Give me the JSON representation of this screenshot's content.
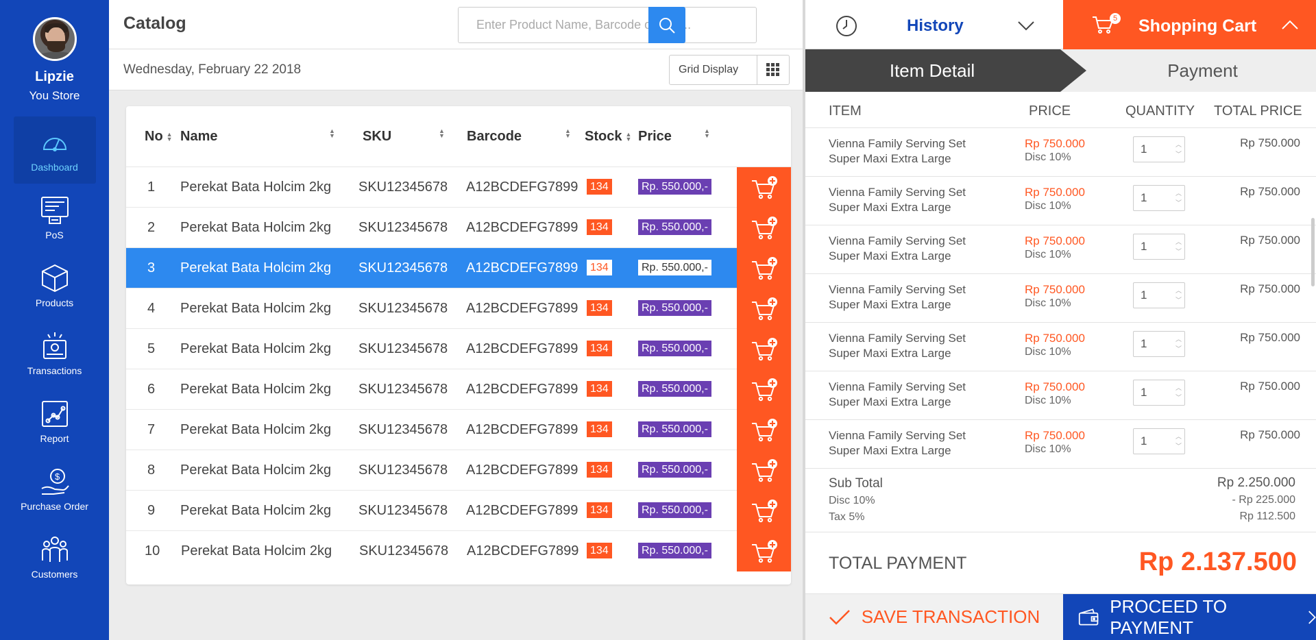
{
  "user": {
    "name": "Lipzie",
    "store": "You Store"
  },
  "nav": [
    {
      "label": "Dashboard",
      "icon": "dashboard-icon",
      "active": true
    },
    {
      "label": "PoS",
      "icon": "pos-icon"
    },
    {
      "label": "Products",
      "icon": "products-icon"
    },
    {
      "label": "Transactions",
      "icon": "transactions-icon"
    },
    {
      "label": "Report",
      "icon": "report-icon"
    },
    {
      "label": "Purchase Order",
      "icon": "purchase-order-icon"
    },
    {
      "label": "Customers",
      "icon": "customers-icon"
    }
  ],
  "catalog": {
    "title": "Catalog",
    "search_placeholder": "Enter Product Name, Barcode or SKU..",
    "date": "Wednesday, February 22 2018",
    "display_mode": "Grid Display",
    "columns": [
      "No",
      "Name",
      "SKU",
      "Barcode",
      "Stock",
      "Price"
    ],
    "rows": [
      {
        "no": "1",
        "name": "Perekat Bata Holcim 2kg",
        "sku": "SKU12345678",
        "barcode": "A12BCDEFG7899",
        "stock": "134",
        "price": "Rp. 550.000,-"
      },
      {
        "no": "2",
        "name": "Perekat Bata Holcim 2kg",
        "sku": "SKU12345678",
        "barcode": "A12BCDEFG7899",
        "stock": "134",
        "price": "Rp. 550.000,-"
      },
      {
        "no": "3",
        "name": "Perekat Bata Holcim 2kg",
        "sku": "SKU12345678",
        "barcode": "A12BCDEFG7899",
        "stock": "134",
        "price": "Rp. 550.000,-",
        "selected": true
      },
      {
        "no": "4",
        "name": "Perekat Bata Holcim 2kg",
        "sku": "SKU12345678",
        "barcode": "A12BCDEFG7899",
        "stock": "134",
        "price": "Rp. 550.000,-"
      },
      {
        "no": "5",
        "name": "Perekat Bata Holcim 2kg",
        "sku": "SKU12345678",
        "barcode": "A12BCDEFG7899",
        "stock": "134",
        "price": "Rp. 550.000,-"
      },
      {
        "no": "6",
        "name": "Perekat Bata Holcim 2kg",
        "sku": "SKU12345678",
        "barcode": "A12BCDEFG7899",
        "stock": "134",
        "price": "Rp. 550.000,-"
      },
      {
        "no": "7",
        "name": "Perekat Bata Holcim 2kg",
        "sku": "SKU12345678",
        "barcode": "A12BCDEFG7899",
        "stock": "134",
        "price": "Rp. 550.000,-"
      },
      {
        "no": "8",
        "name": "Perekat Bata Holcim 2kg",
        "sku": "SKU12345678",
        "barcode": "A12BCDEFG7899",
        "stock": "134",
        "price": "Rp. 550.000,-"
      },
      {
        "no": "9",
        "name": "Perekat Bata Holcim 2kg",
        "sku": "SKU12345678",
        "barcode": "A12BCDEFG7899",
        "stock": "134",
        "price": "Rp. 550.000,-"
      },
      {
        "no": "10",
        "name": "Perekat Bata Holcim 2kg",
        "sku": "SKU12345678",
        "barcode": "A12BCDEFG7899",
        "stock": "134",
        "price": "Rp. 550.000,-"
      }
    ]
  },
  "history": {
    "label": "History"
  },
  "cart": {
    "label": "Shopping Cart",
    "count": "5",
    "steps": {
      "active": "Item Detail",
      "next": "Payment"
    },
    "columns": {
      "item": "ITEM",
      "price": "PRICE",
      "quantity": "QUANTITY",
      "total": "TOTAL PRICE"
    },
    "items": [
      {
        "name1": "Vienna Family Serving Set",
        "name2": "Super Maxi Extra Large",
        "price": "Rp 750.000",
        "disc": "Disc 10%",
        "qty": "1",
        "total": "Rp 750.000"
      },
      {
        "name1": "Vienna Family Serving Set",
        "name2": "Super Maxi Extra Large",
        "price": "Rp 750.000",
        "disc": "Disc 10%",
        "qty": "1",
        "total": "Rp 750.000"
      },
      {
        "name1": "Vienna Family Serving Set",
        "name2": "Super Maxi Extra Large",
        "price": "Rp 750.000",
        "disc": "Disc 10%",
        "qty": "1",
        "total": "Rp 750.000"
      },
      {
        "name1": "Vienna Family Serving Set",
        "name2": "Super Maxi Extra Large",
        "price": "Rp 750.000",
        "disc": "Disc 10%",
        "qty": "1",
        "total": "Rp 750.000"
      },
      {
        "name1": "Vienna Family Serving Set",
        "name2": "Super Maxi Extra Large",
        "price": "Rp 750.000",
        "disc": "Disc 10%",
        "qty": "1",
        "total": "Rp 750.000"
      },
      {
        "name1": "Vienna Family Serving Set",
        "name2": "Super Maxi Extra Large",
        "price": "Rp 750.000",
        "disc": "Disc 10%",
        "qty": "1",
        "total": "Rp 750.000"
      },
      {
        "name1": "Vienna Family Serving Set",
        "name2": "Super Maxi Extra Large",
        "price": "Rp 750.000",
        "disc": "Disc 10%",
        "qty": "1",
        "total": "Rp 750.000"
      }
    ],
    "subtotal_label": "Sub Total",
    "subtotal": "Rp 2.250.000",
    "disc_label": "Disc 10%",
    "disc": "- Rp 225.000",
    "tax_label": "Tax 5%",
    "tax": "Rp 112.500",
    "total_label": "TOTAL PAYMENT",
    "total": "Rp 2.137.500",
    "save_label": "SAVE TRANSACTION",
    "proceed_label": "PROCEED TO PAYMENT"
  },
  "colors": {
    "sidebar": "#1246b8",
    "accent": "#ff5722",
    "selected_row": "#2d89ef",
    "price_badge": "#6a3fb2"
  }
}
